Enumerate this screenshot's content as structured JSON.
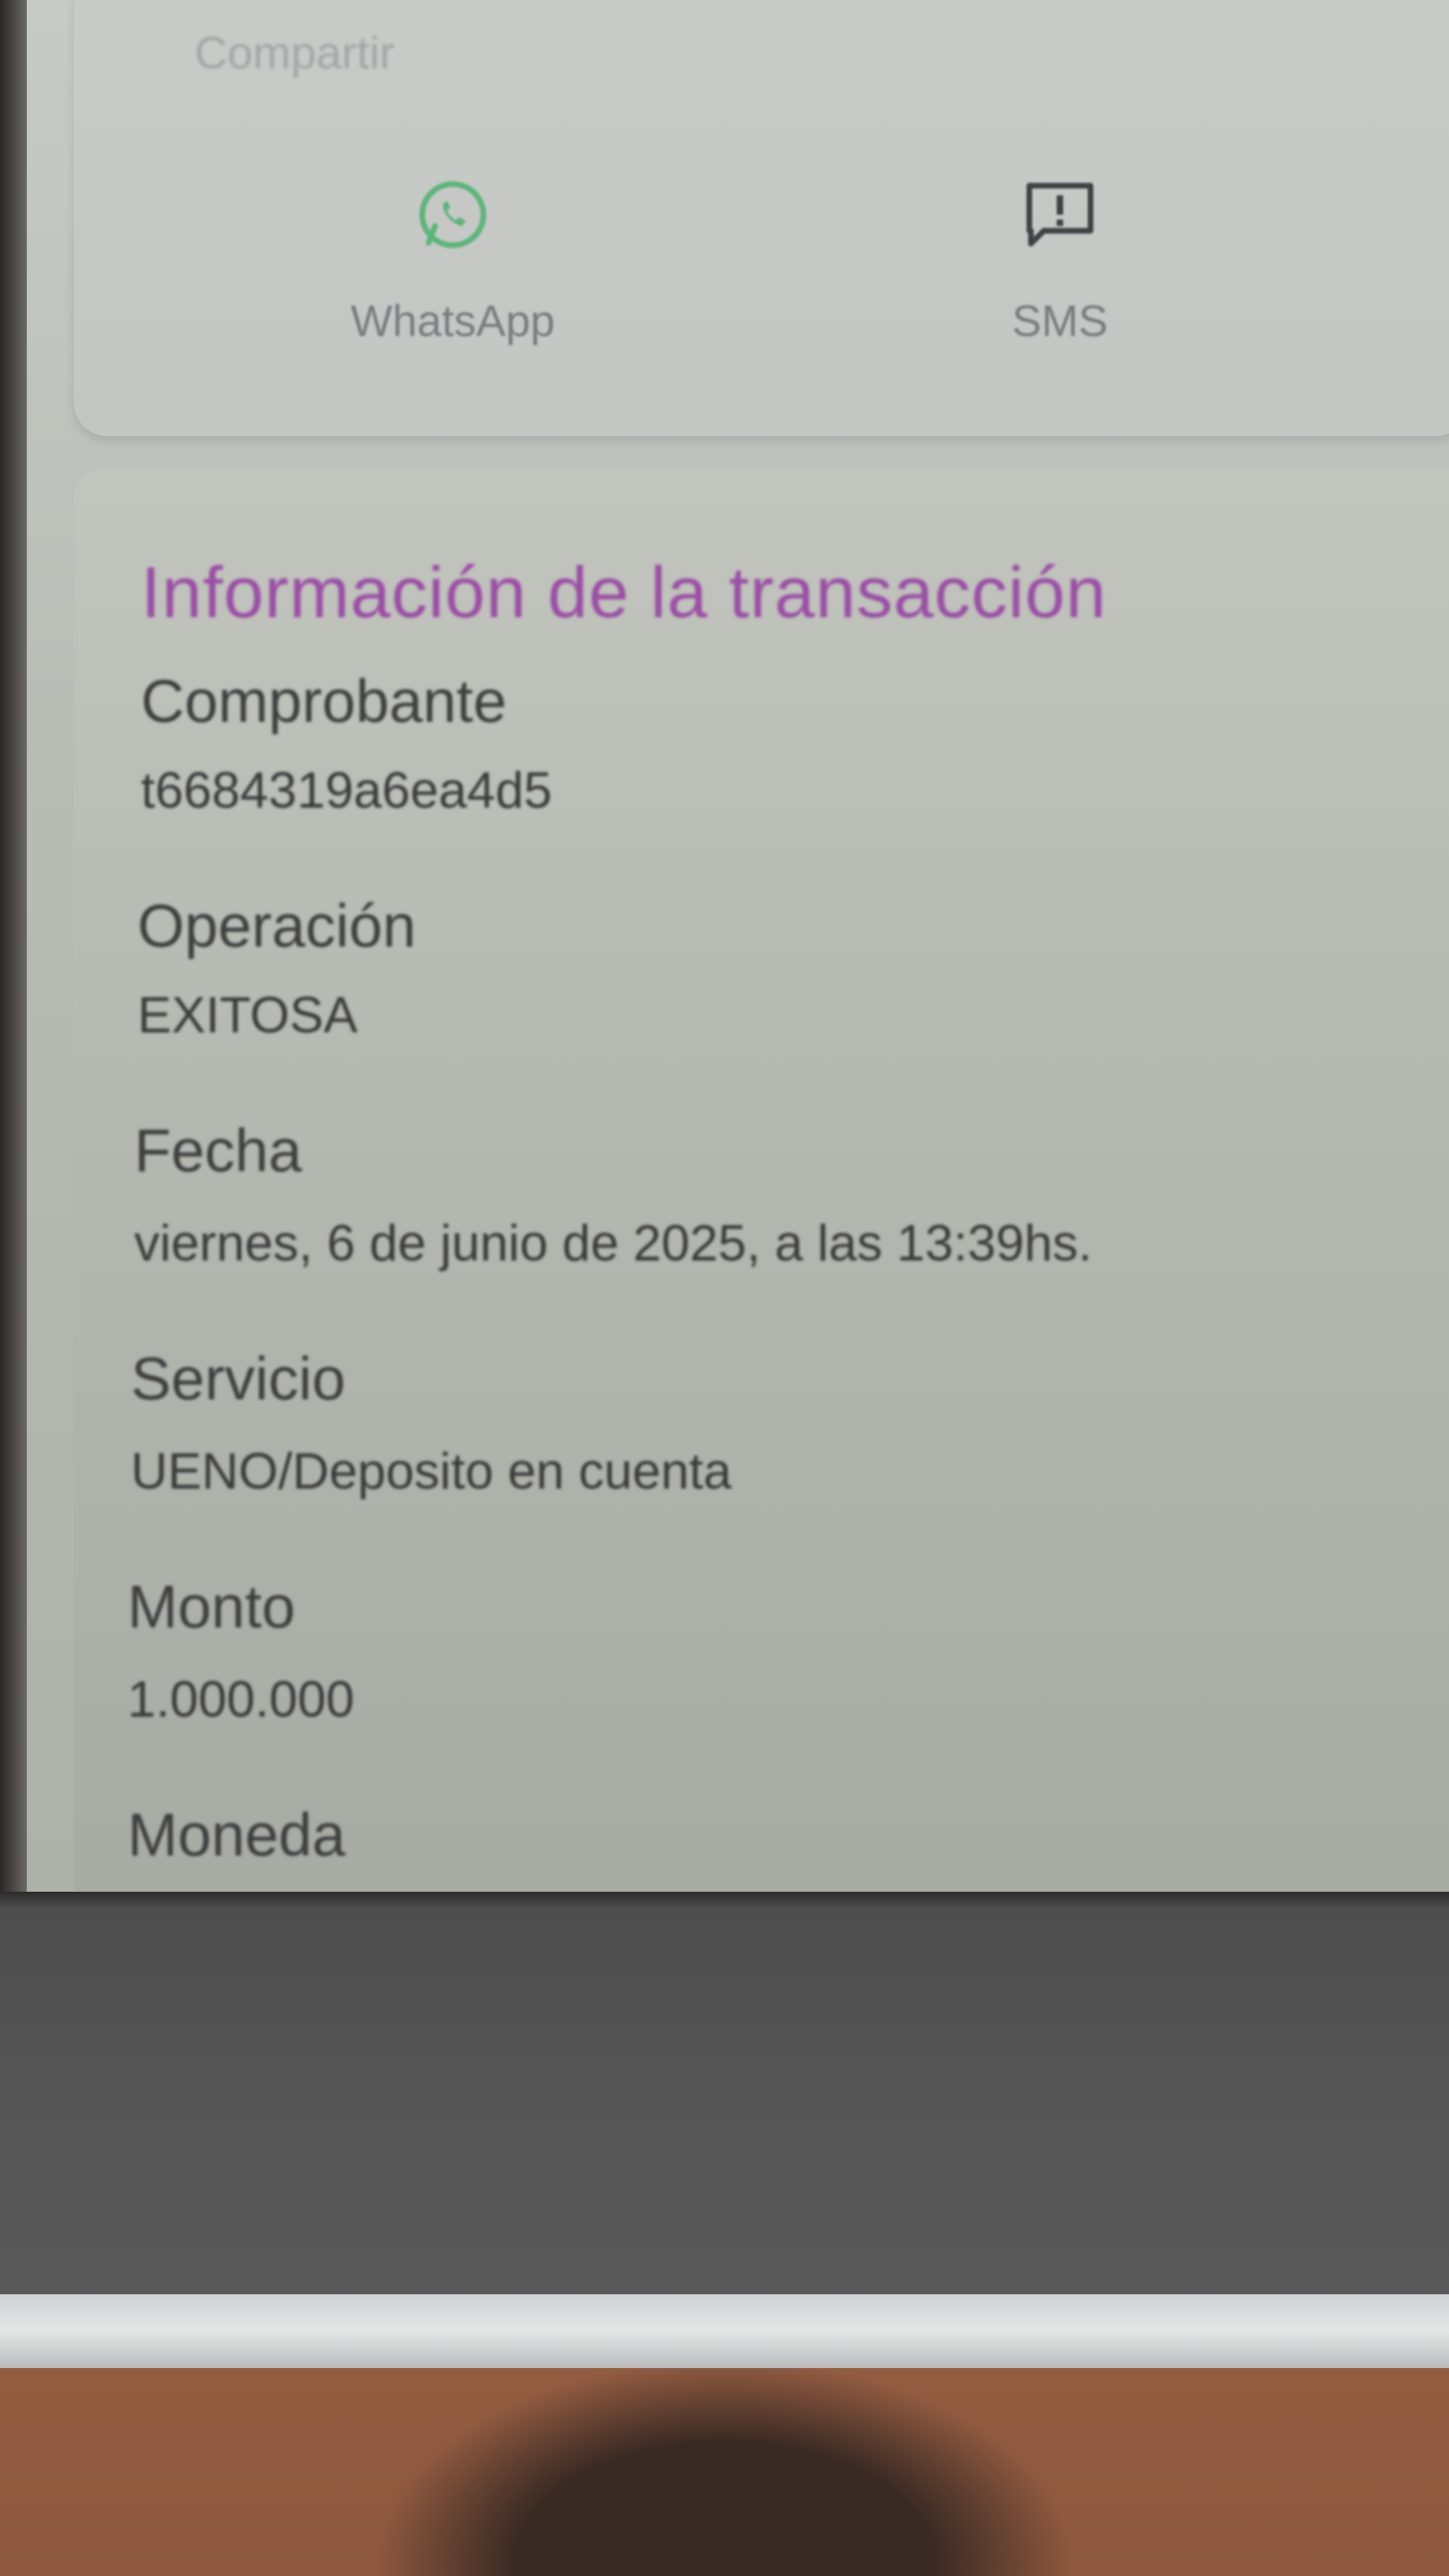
{
  "share": {
    "title": "Compartir",
    "options": [
      {
        "label": "WhatsApp",
        "icon": "whatsapp-icon",
        "color": "#4caf6e"
      },
      {
        "label": "SMS",
        "icon": "sms-alert-icon",
        "color": "#404040"
      }
    ]
  },
  "transaction": {
    "title": "Información de la transacción",
    "title_color": "#9a4fa5",
    "fields": [
      {
        "label": "Comprobante",
        "value": "t6684319a6ea4d5"
      },
      {
        "label": "Operación",
        "value": "EXITOSA"
      },
      {
        "label": "Fecha",
        "value": "viernes, 6 de junio de 2025, a las 13:39hs."
      },
      {
        "label": "Servicio",
        "value": "UENO/Deposito en cuenta"
      },
      {
        "label": "Monto",
        "value": "1.000.000"
      },
      {
        "label": "Moneda",
        "value": ""
      }
    ]
  }
}
